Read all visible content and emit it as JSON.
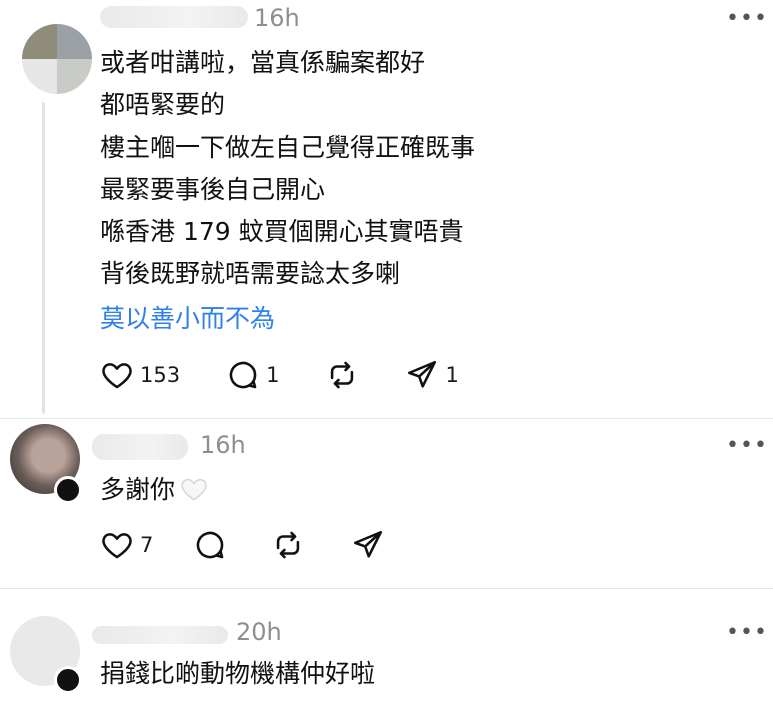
{
  "post1": {
    "time": "16h",
    "more": "•••",
    "lines": [
      "或者咁講啦，當真係騙案都好",
      "都唔緊要的",
      "樓主嗰一下做左自己覺得正確既事",
      "最緊要事後自己開心",
      "喺香港 179 蚊買個開心其實唔貴",
      "背後既野就唔需要諗太多喇"
    ],
    "tagline": "莫以善小而不為",
    "likes": "153",
    "comments": "1",
    "shares": "1"
  },
  "post2": {
    "time": "16h",
    "more": "•••",
    "text": "多謝你",
    "likes": "7"
  },
  "post3": {
    "time": "20h",
    "more": "•••",
    "text": "捐錢比啲動物機構仲好啦"
  }
}
